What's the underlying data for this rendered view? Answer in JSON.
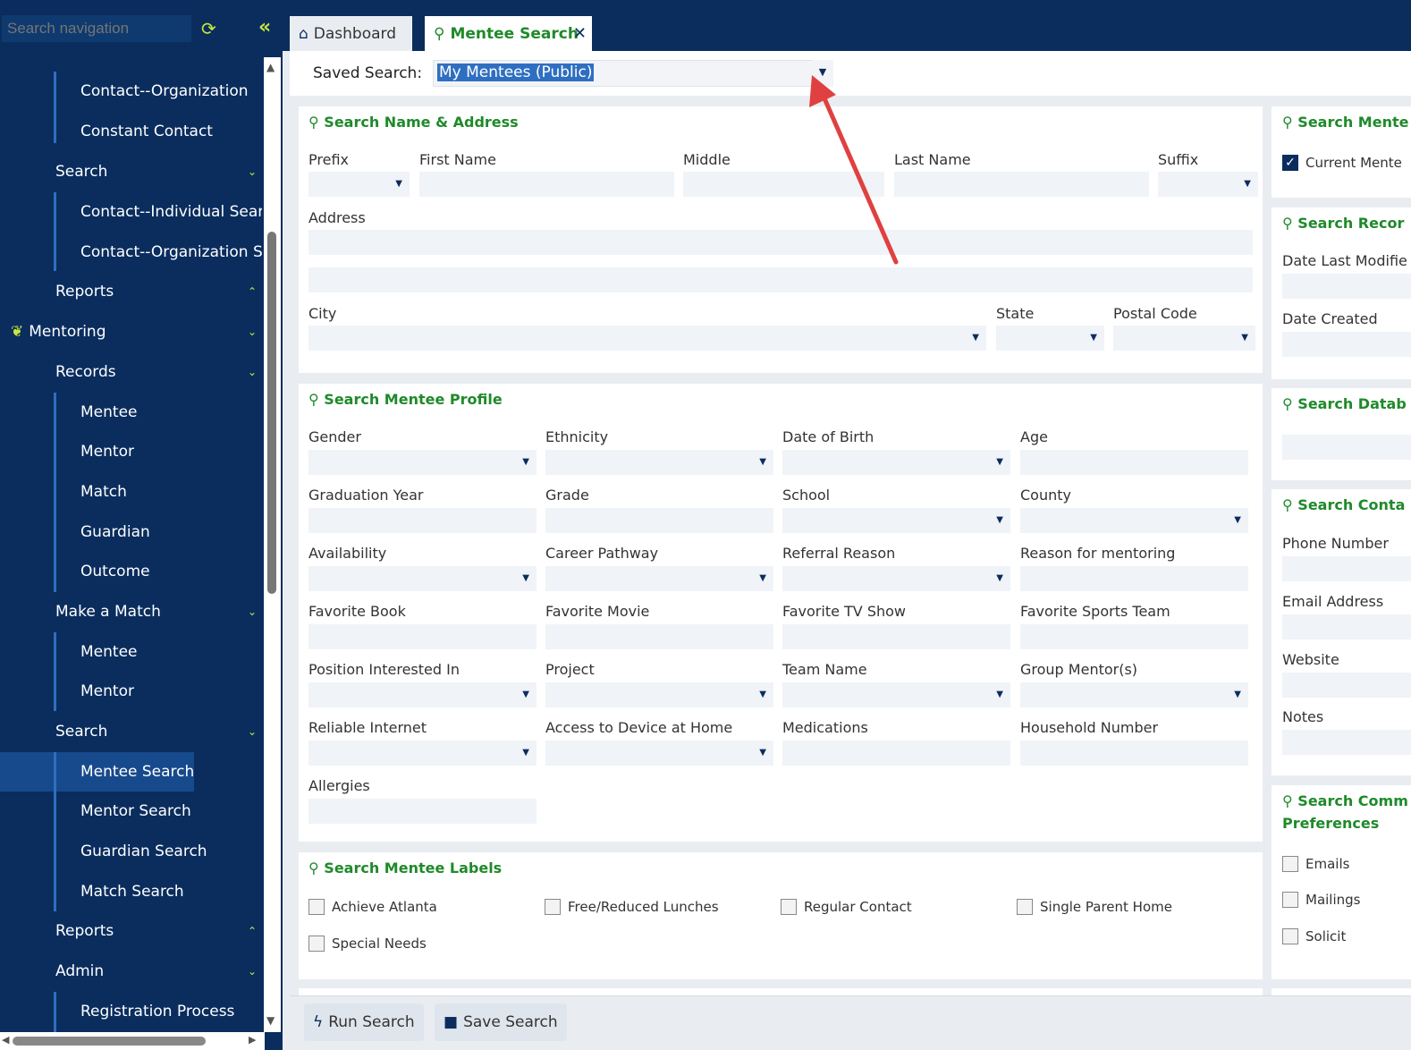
{
  "sidebar": {
    "search_placeholder": "Search navigation",
    "items": [
      {
        "label": "Contact--Organization"
      },
      {
        "label": "Constant Contact"
      },
      {
        "label": "Search"
      },
      {
        "label": "Contact--Individual Sear"
      },
      {
        "label": "Contact--Organization S"
      },
      {
        "label": "Reports"
      },
      {
        "label": "Mentoring"
      },
      {
        "label": "Records"
      },
      {
        "label": "Mentee"
      },
      {
        "label": "Mentor"
      },
      {
        "label": "Match"
      },
      {
        "label": "Guardian"
      },
      {
        "label": "Outcome"
      },
      {
        "label": "Make a Match"
      },
      {
        "label": "Mentee"
      },
      {
        "label": "Mentor"
      },
      {
        "label": "Search"
      },
      {
        "label": "Mentee Search"
      },
      {
        "label": "Mentor Search"
      },
      {
        "label": "Guardian Search"
      },
      {
        "label": "Match Search"
      },
      {
        "label": "Reports"
      },
      {
        "label": "Admin"
      },
      {
        "label": "Registration Process"
      }
    ]
  },
  "tabs": {
    "dashboard": "Dashboard",
    "mentee_search": "Mentee Search"
  },
  "saved_search": {
    "label": "Saved Search:",
    "value": "My Mentees (Public)"
  },
  "name_address": {
    "title": "Search Name & Address",
    "prefix": "Prefix",
    "first": "First Name",
    "middle": "Middle",
    "last": "Last Name",
    "suffix": "Suffix",
    "address": "Address",
    "city": "City",
    "state": "State",
    "postal": "Postal Code"
  },
  "profile": {
    "title": "Search Mentee Profile",
    "fields": [
      "Gender",
      "Ethnicity",
      "Date of Birth",
      "Age",
      "Graduation Year",
      "Grade",
      "School",
      "County",
      "Availability",
      "Career Pathway",
      "Referral Reason",
      "Reason for mentoring",
      "Favorite Book",
      "Favorite Movie",
      "Favorite TV Show",
      "Favorite Sports Team",
      "Position Interested In",
      "Project",
      "Team Name",
      "Group Mentor(s)",
      "Reliable Internet",
      "Access to Device at Home",
      "Medications",
      "Household Number",
      "Allergies"
    ]
  },
  "labels": {
    "title": "Search Mentee Labels",
    "options": [
      "Achieve Atlanta",
      "Free/Reduced Lunches",
      "Regular Contact",
      "Single Parent Home",
      "Special Needs"
    ]
  },
  "right": {
    "mentee_title": "Search Mente",
    "current": "Current Mente",
    "record_title": "Search Recor",
    "date_modified": "Date Last Modifie",
    "date_created": "Date Created",
    "database_title": "Search Datab",
    "contact_title": "Search Conta",
    "phone": "Phone Number",
    "email": "Email Address",
    "website": "Website",
    "notes": "Notes",
    "comm_title": "Search Comm",
    "comm_title2": "Preferences",
    "emails": "Emails",
    "mailings": "Mailings",
    "solicit": "Solicit"
  },
  "footer": {
    "run": "Run Search",
    "save": "Save Search"
  }
}
